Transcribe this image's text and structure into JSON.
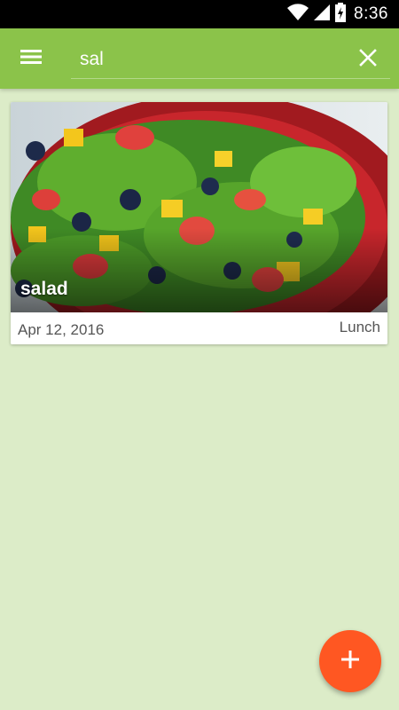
{
  "status_bar": {
    "time": "8:36",
    "icons": [
      "wifi-icon",
      "cell-signal-icon",
      "battery-charging-icon"
    ]
  },
  "app_bar": {
    "menu_icon": "hamburger-menu-icon",
    "search": {
      "value": "sal",
      "placeholder": ""
    },
    "clear_icon": "close-icon"
  },
  "results": [
    {
      "title": "salad",
      "date": "Apr 12, 2016",
      "meal": "Lunch",
      "image": "salad-photo"
    }
  ],
  "fab": {
    "icon": "plus-icon",
    "color": "#ff5722"
  },
  "colors": {
    "primary": "#8bc34a",
    "background": "#dcecc8",
    "status_bar": "#000000",
    "accent": "#ff5722"
  }
}
